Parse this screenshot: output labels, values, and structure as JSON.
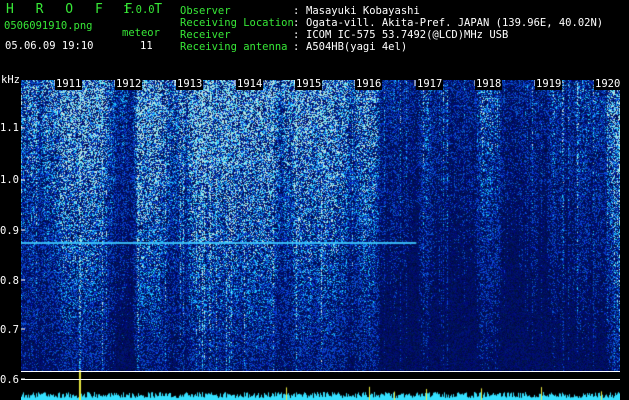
{
  "header": {
    "app_title": "H R O F F T",
    "app_version": "1.0.0",
    "filename": "0506091910.png",
    "timestamp": "05.06.09 19:10",
    "meteor_label": "meteor",
    "meteor_count": "11"
  },
  "info": [
    {
      "label": "Observer",
      "value": "Masayuki Kobayashi"
    },
    {
      "label": "Receiving Location",
      "value": "Ogata-vill. Akita-Pref. JAPAN (139.96E, 40.02N)"
    },
    {
      "label": "Receiver",
      "value": "ICOM IC-575 53.7492(@LCD)MHz USB"
    },
    {
      "label": "Receiving antenna",
      "value": "A504HB(yagi 4el)"
    }
  ],
  "spectrogram": {
    "freq_unit": "kHz",
    "freq_ticks": [
      "1.1",
      "1.0",
      "0.9",
      "0.8",
      "0.7",
      "0.6"
    ],
    "minute_labels": [
      "1911",
      "1912",
      "1913",
      "1914",
      "1915",
      "1916",
      "1917",
      "1918",
      "1919",
      "1920"
    ],
    "colors": {
      "background": "#00002a",
      "noise_low": "#0a1a9e",
      "noise_high": "#2fb8ff",
      "bright": "#9fffd0",
      "grid_line": "#ffffff",
      "level_trace": "#35e0ff"
    }
  }
}
